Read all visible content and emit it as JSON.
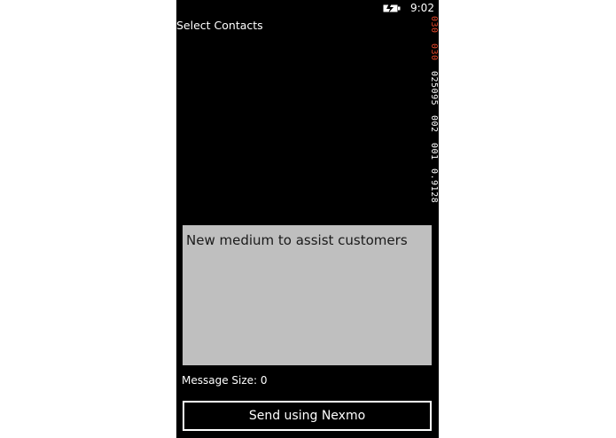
{
  "status_bar": {
    "time": "9:02",
    "icon": "battery-charging-icon"
  },
  "page": {
    "title": "Select Contacts"
  },
  "debug_counters": [
    {
      "value": "030",
      "color": "#e0462a"
    },
    {
      "value": "030",
      "color": "#e0462a"
    },
    {
      "value": "025095",
      "color": "#ffffff"
    },
    {
      "value": "002",
      "color": "#ffffff"
    },
    {
      "value": "001",
      "color": "#ffffff"
    },
    {
      "value": "0.9128",
      "color": "#ffffff"
    }
  ],
  "message": {
    "value": "New medium to assist customers"
  },
  "message_size": {
    "text": "Message Size: 0"
  },
  "send_button": {
    "label": "Send using Nexmo"
  },
  "colors": {
    "background": "#000000",
    "textbox": "#bfbfbf",
    "foreground": "#ffffff",
    "counter_accent": "#e0462a"
  }
}
